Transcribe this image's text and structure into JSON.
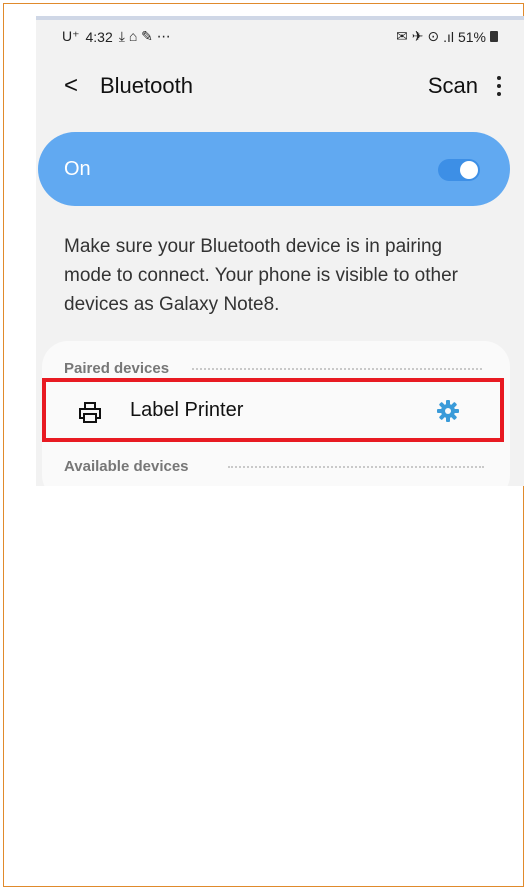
{
  "status_bar": {
    "carrier": "U⁺",
    "time": "4:32",
    "left_icons": "⤓ ⌂ ✎ ⋯",
    "right_icons": "✉ ✈ ⊙",
    "signal": ".ıl",
    "battery": "51%"
  },
  "header": {
    "back_glyph": "<",
    "title": "Bluetooth",
    "scan_label": "Scan"
  },
  "toggle_bar": {
    "label": "On",
    "state": "on",
    "color": "#61a9f1"
  },
  "description": "Make sure your Bluetooth device is in pairing mode to connect. Your phone is visible to other devices as Galaxy Note8.",
  "paired_devices": {
    "section_title": "Paired devices",
    "items": [
      {
        "name": "Label Printer",
        "icon": "printer-icon",
        "action_icon": "gear-icon"
      }
    ]
  },
  "available_devices": {
    "section_title": "Available devices"
  },
  "colors": {
    "accent": "#61a9f1",
    "gear": "#3a9bd9",
    "highlight": "#e81a22",
    "frame": "#e08a2c"
  }
}
